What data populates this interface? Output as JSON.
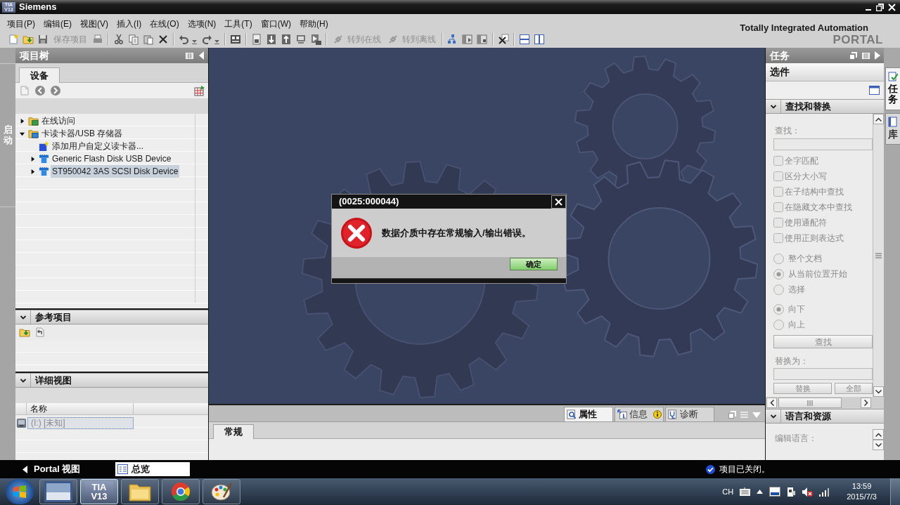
{
  "title_bar": {
    "logo": {
      "line_1": "TIA",
      "line_2": "V13"
    },
    "title": "Siemens"
  },
  "menu_bar": [
    "项目(P)",
    "编辑(E)",
    "视图(V)",
    "插入(I)",
    "在线(O)",
    "选项(N)",
    "工具(T)",
    "窗口(W)",
    "帮助(H)"
  ],
  "toolbar": {
    "buttons": [
      {
        "label": "保存项目",
        "disabled": true
      },
      {
        "label": "转到在线",
        "disabled": true
      },
      {
        "label": "转到离线",
        "disabled": true
      }
    ]
  },
  "branding": {
    "line_1": "Totally Integrated Automation",
    "line_2": "PORTAL"
  },
  "start_strip": {
    "label": "启动"
  },
  "project_tree": {
    "title": "项目树",
    "tabs": [
      {
        "label": "设备",
        "selected": true
      }
    ],
    "items": [
      {
        "kind": "folder-online",
        "label": "在线访问",
        "expanded": false,
        "selected": false
      },
      {
        "kind": "folder-device",
        "label": "卡读卡器/USB 存储器",
        "expanded": true,
        "selected": false,
        "children": [
          {
            "kind": "add",
            "label": "添加用户自定义读卡器...",
            "selected": false
          },
          {
            "kind": "device",
            "label": "Generic Flash Disk USB Device",
            "expanded": false,
            "selected": false
          },
          {
            "kind": "device",
            "label": "ST950042 3AS SCSI Disk Device",
            "expanded": false,
            "selected": true
          }
        ]
      }
    ]
  },
  "reference_projects": {
    "title": "参考项目",
    "expanded": true
  },
  "details_view": {
    "title": "详细视图",
    "expanded": true,
    "columns": [
      "名称"
    ],
    "rows": [
      {
        "cells": [
          "(I:) [未知]"
        ],
        "selected": true
      }
    ]
  },
  "dialog": {
    "title": "(0025:000044)",
    "message": "数据介质中存在常规输入/输出错误。",
    "buttons": [
      "确定"
    ]
  },
  "inspector": {
    "tabs": [
      {
        "kind": "properties",
        "label": "属性",
        "selected": true
      },
      {
        "kind": "info",
        "label": "信息",
        "selected": false
      },
      {
        "kind": "diagnostics",
        "label": "诊断",
        "selected": false
      }
    ],
    "subtabs": [
      {
        "label": "常规",
        "selected": true
      }
    ]
  },
  "task_panel": {
    "title": "任务",
    "heading": "选件",
    "find_replace": {
      "title": "查找和替换",
      "expanded": true,
      "find_label": "查找：",
      "options": [
        {
          "label": "全字匹配",
          "checked": false
        },
        {
          "label": "区分大小写",
          "checked": false
        },
        {
          "label": "在子结构中查找",
          "checked": false
        },
        {
          "label": "在隐藏文本中查找",
          "checked": false
        },
        {
          "label": "使用通配符",
          "checked": false
        },
        {
          "label": "使用正则表达式",
          "checked": false
        }
      ],
      "scope": [
        {
          "label": "整个文档",
          "selected": false
        },
        {
          "label": "从当前位置开始",
          "selected": true
        },
        {
          "label": "选择",
          "selected": false
        }
      ],
      "direction": [
        {
          "label": "向下",
          "selected": true
        },
        {
          "label": "向上",
          "selected": false
        }
      ],
      "find_button": "查找",
      "replace_label": "替换为：",
      "buttons": [
        "替换",
        "全部"
      ]
    },
    "language_resources": {
      "title": "语言和资源",
      "expanded": true,
      "edit_language_label": "编辑语言："
    }
  },
  "side_tabs": [
    {
      "label": "任务",
      "selected": true
    },
    {
      "label": "库",
      "selected": false
    }
  ],
  "status_bar": {
    "portal_view": "Portal 视图",
    "tabs": [
      {
        "label": "总览",
        "selected": true
      }
    ],
    "message": "项目已关闭。"
  },
  "taskbar": {
    "apps": [
      {
        "kind": "image",
        "selected": false
      },
      {
        "kind": "tia",
        "selected": true,
        "logo": {
          "line_1": "TIA",
          "line_2": "V13"
        }
      },
      {
        "kind": "folder",
        "selected": false
      },
      {
        "kind": "browser",
        "selected": false
      },
      {
        "kind": "paint",
        "selected": false
      }
    ],
    "tray": {
      "language": "CH",
      "time": "13:59",
      "date": "2015/7/3"
    }
  }
}
